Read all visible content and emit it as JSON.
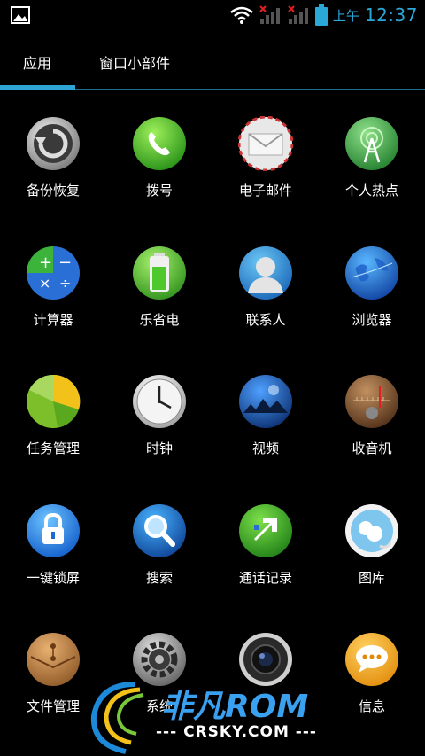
{
  "status_bar": {
    "ampm": "上午",
    "time": "12:37"
  },
  "tabs": [
    {
      "label": "应用"
    },
    {
      "label": "窗口小部件"
    }
  ],
  "apps": [
    {
      "label": "备份恢复",
      "icon": "backup-restore-icon"
    },
    {
      "label": "拨号",
      "icon": "phone-icon"
    },
    {
      "label": "电子邮件",
      "icon": "email-icon"
    },
    {
      "label": "个人热点",
      "icon": "hotspot-icon"
    },
    {
      "label": "计算器",
      "icon": "calculator-icon"
    },
    {
      "label": "乐省电",
      "icon": "battery-icon"
    },
    {
      "label": "联系人",
      "icon": "contacts-icon"
    },
    {
      "label": "浏览器",
      "icon": "browser-globe-icon"
    },
    {
      "label": "任务管理",
      "icon": "task-manager-pie-icon"
    },
    {
      "label": "时钟",
      "icon": "clock-icon"
    },
    {
      "label": "视频",
      "icon": "video-icon"
    },
    {
      "label": "收音机",
      "icon": "radio-icon"
    },
    {
      "label": "一键锁屏",
      "icon": "lock-icon"
    },
    {
      "label": "搜索",
      "icon": "search-icon"
    },
    {
      "label": "通话记录",
      "icon": "call-log-icon"
    },
    {
      "label": "图库",
      "icon": "gallery-icon"
    },
    {
      "label": "文件管理",
      "icon": "file-manager-icon"
    },
    {
      "label": "系统",
      "icon": "settings-gear-icon"
    },
    {
      "label": "",
      "icon": "camera-icon"
    },
    {
      "label": "信息",
      "icon": "messaging-icon"
    }
  ],
  "watermark": {
    "title": "非凡ROM",
    "subtitle": "--- CRSKY.COM ---"
  }
}
